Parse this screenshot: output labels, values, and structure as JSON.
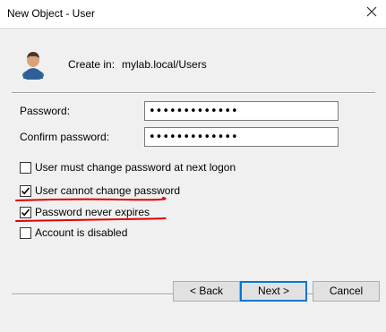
{
  "window": {
    "title": "New Object - User"
  },
  "header": {
    "create_in_label": "Create in:",
    "create_in_value": "mylab.local/Users",
    "user_icon": "user-icon"
  },
  "form": {
    "password_label": "Password:",
    "password_value": "•••••••••••••",
    "confirm_label": "Confirm password:",
    "confirm_value": "•••••••••••••"
  },
  "options": [
    {
      "label": "User must change password at next logon",
      "checked": false
    },
    {
      "label": "User cannot change password",
      "checked": true
    },
    {
      "label": "Password never expires",
      "checked": true
    },
    {
      "label": "Account is disabled",
      "checked": false
    }
  ],
  "buttons": {
    "back": "< Back",
    "next": "Next >",
    "cancel": "Cancel"
  },
  "colors": {
    "annotation": "#e00000",
    "accent": "#0078d7",
    "dialog_bg": "#f0f0f0"
  }
}
